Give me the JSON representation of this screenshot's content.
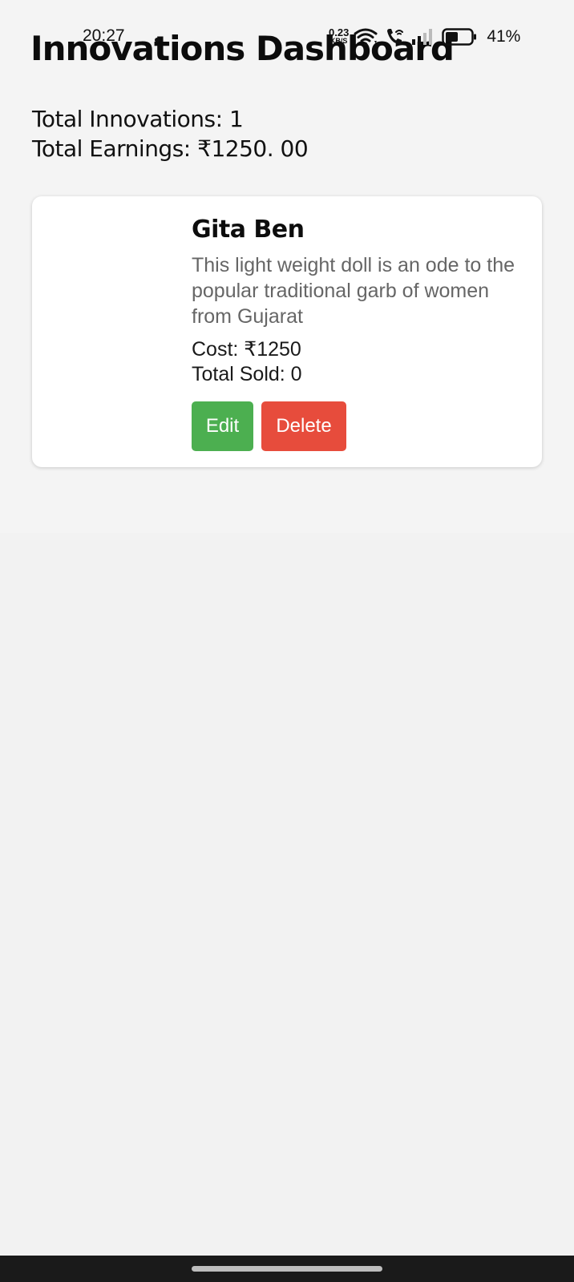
{
  "status_bar": {
    "time": "20:27",
    "net_speed_value": "0.23",
    "net_speed_unit": "KB/S",
    "battery_percent": "41%"
  },
  "header": {
    "title": "Innovations Dashboard"
  },
  "summary": {
    "total_innovations_label": "Total Innovations: 1",
    "total_earnings_label": "Total Earnings: ₹1250. 00"
  },
  "innovations": [
    {
      "name": "Gita Ben",
      "description": "This light weight doll is an ode to the popular traditional garb of women from Gujarat",
      "cost_label": "Cost: ₹1250",
      "sold_label": "Total Sold: 0",
      "edit_label": "Edit",
      "delete_label": "Delete"
    }
  ],
  "colors": {
    "edit_button": "#4caf50",
    "delete_button": "#e74c3c",
    "background": "#f2f2f2",
    "card": "#ffffff"
  },
  "icons": [
    "wifi-icon",
    "wifi-calling-icon",
    "signal-icon",
    "battery-icon"
  ]
}
